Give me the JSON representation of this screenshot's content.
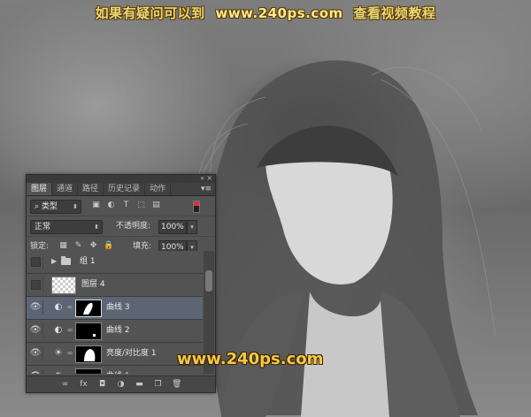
{
  "banner": {
    "prefix": "如果有疑问可以到",
    "url": "www.240ps.com",
    "suffix": "查看视频教程"
  },
  "watermark": "www.240ps.com",
  "panel": {
    "tabs": [
      {
        "label": "图层",
        "active": true
      },
      {
        "label": "通道",
        "active": false
      },
      {
        "label": "路径",
        "active": false
      },
      {
        "label": "历史记录",
        "active": false
      },
      {
        "label": "动作",
        "active": false
      }
    ],
    "filter_kind": "类型",
    "blend_mode": "正常",
    "opacity_label": "不透明度:",
    "opacity_value": "100%",
    "lock_label": "锁定:",
    "fill_label": "填充:",
    "fill_value": "100%",
    "layers": [
      {
        "name": "组 1",
        "type": "group",
        "visible": false,
        "selected": false
      },
      {
        "name": "图层 4",
        "type": "pixel",
        "visible": false,
        "selected": false
      },
      {
        "name": "曲线 3",
        "type": "curves",
        "visible": true,
        "selected": true
      },
      {
        "name": "曲线 2",
        "type": "curves",
        "visible": true,
        "selected": false
      },
      {
        "name": "亮度/对比度 1",
        "type": "brightness",
        "visible": true,
        "selected": false
      },
      {
        "name": "曲线 1",
        "type": "curves",
        "visible": true,
        "selected": false
      }
    ]
  },
  "colors": {
    "panel_bg": "#535353",
    "selected_row": "#5b6573",
    "banner_text": "#e9d77a",
    "watermark_text": "#f4c84a"
  }
}
